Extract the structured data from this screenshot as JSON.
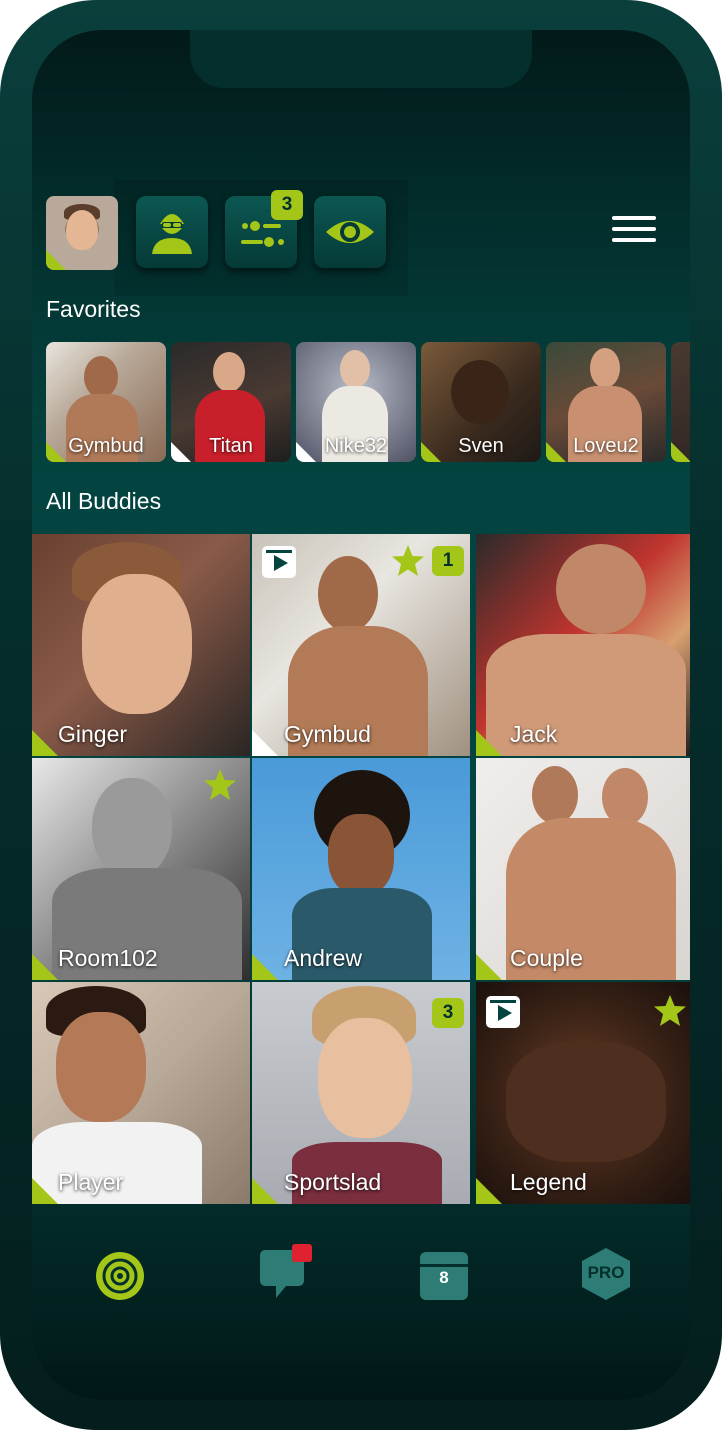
{
  "header": {
    "notifications_count": "3",
    "menu_icon": "hamburger-icon"
  },
  "favorites": {
    "title": "Favorites",
    "items": [
      {
        "name": "Gymbud",
        "corner": "lime"
      },
      {
        "name": "Titan",
        "corner": "white"
      },
      {
        "name": "Nike32",
        "corner": "white"
      },
      {
        "name": "Sven",
        "corner": "lime"
      },
      {
        "name": "Loveu2",
        "corner": "lime"
      },
      {
        "name": "",
        "corner": "lime"
      }
    ]
  },
  "buddies": {
    "title": "All Buddies",
    "items": [
      {
        "name": "Ginger"
      },
      {
        "name": "Gymbud",
        "badge": "1"
      },
      {
        "name": "Jack"
      },
      {
        "name": "Room102"
      },
      {
        "name": "Andrew"
      },
      {
        "name": "Couple"
      },
      {
        "name": "Player"
      },
      {
        "name": "Sportslad",
        "badge": "3"
      },
      {
        "name": "Legend"
      }
    ]
  },
  "bottom_nav": {
    "radar_icon": "radar-icon",
    "chat_icon": "chat-icon",
    "calendar_day": "8",
    "pro_label": "PRO"
  },
  "colors": {
    "accent": "#a3c619",
    "background": "#044440",
    "notification": "#e0212f"
  }
}
